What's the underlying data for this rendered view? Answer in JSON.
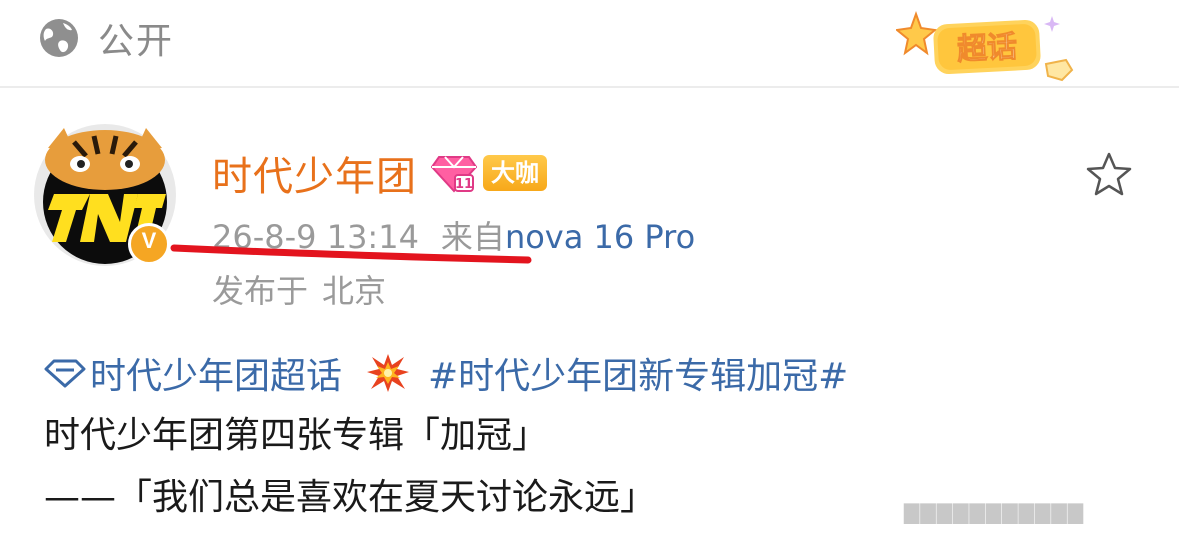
{
  "header": {
    "visibility_label": "公开",
    "supertopic_badge_label": "超话"
  },
  "post": {
    "author_name": "时代少年团",
    "author_title_badge": "大咖",
    "timestamp": "26-8-9 13:14",
    "source_prefix": "来自",
    "source_device": "nova 16 Pro",
    "location_prefix": "发布于",
    "location": "北京",
    "content": {
      "supertopic_link": "时代少年团超话",
      "hashtag": "#时代少年团新专辑加冠#",
      "line2": "时代少年团第四张专辑「加冠」",
      "line3": "——「我们总是喜欢在夏天讨论永远」"
    }
  },
  "watermark_text": "▇▇▇▇▇▇▇▇▇▇▇",
  "icons": {
    "globe": "globe-icon",
    "star": "star-icon",
    "verify": "verified-v-icon",
    "vip": "diamond-vip-icon",
    "collision": "collision-emoji",
    "supertopic": "diamond-topic-icon"
  },
  "colors": {
    "author_name": "#e8711b",
    "link": "#3b6aa8",
    "meta_gray": "#9a9a9a",
    "underline_red": "#e3141e",
    "badge_gold": "#f7a81a"
  }
}
